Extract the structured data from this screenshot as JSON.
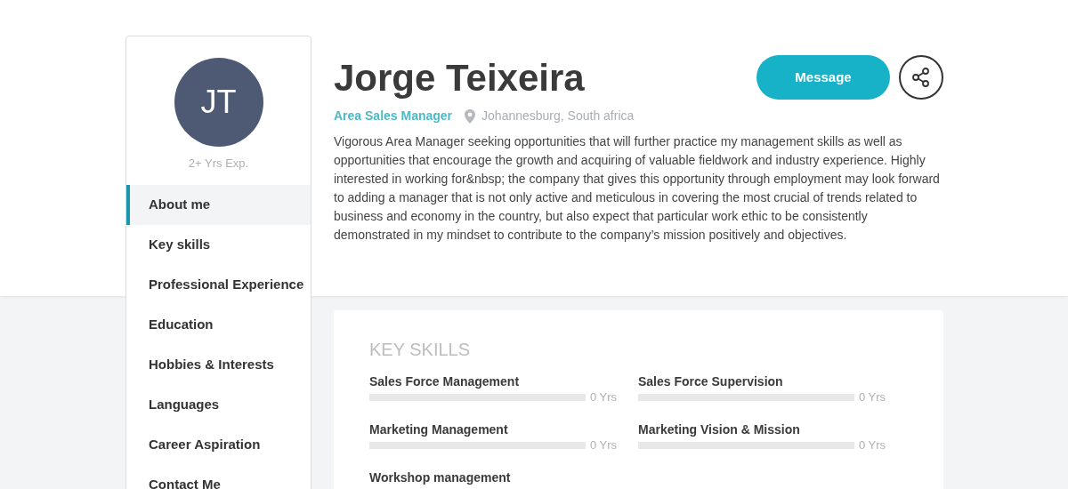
{
  "profile": {
    "initials": "JT",
    "experience": "2+ Yrs Exp.",
    "name": "Jorge Teixeira",
    "role": "Area Sales Manager",
    "location": "Johannesburg, South africa",
    "about": "Vigorous Area Manager seeking opportunities that will further practice my management skills as well as opportunities that encourage the growth and acquiring of valuable fieldwork and industry experience. Highly interested in working for&nbsp; the company that gives this opportunity through employment may look forward to adding a manager that is not only active and meticulous in covering the most crucial of trends related to business and economy in the country, but also expect that particular work ethic to be consistently demonstrated in my mindset to contribute to the company’s mission positively and objectives."
  },
  "actions": {
    "message": "Message"
  },
  "sidebar": {
    "items": [
      {
        "label": "About me",
        "selected": true
      },
      {
        "label": "Key skills",
        "selected": false
      },
      {
        "label": "Professional Experience",
        "selected": false
      },
      {
        "label": "Education",
        "selected": false
      },
      {
        "label": "Hobbies & Interests",
        "selected": false
      },
      {
        "label": "Languages",
        "selected": false
      },
      {
        "label": "Career Aspiration",
        "selected": false
      },
      {
        "label": "Contact Me",
        "selected": false
      }
    ]
  },
  "key_skills": {
    "title": "KEY SKILLS",
    "skills": [
      {
        "name": "Sales Force Management",
        "level": 0,
        "reading": "0 Yrs"
      },
      {
        "name": "Sales Force Supervision",
        "level": 0,
        "reading": "0 Yrs"
      },
      {
        "name": "Marketing Management",
        "level": 0,
        "reading": "0 Yrs"
      },
      {
        "name": "Marketing Vision & Mission",
        "level": 0,
        "reading": "0 Yrs"
      },
      {
        "name": "Workshop management"
      }
    ]
  }
}
